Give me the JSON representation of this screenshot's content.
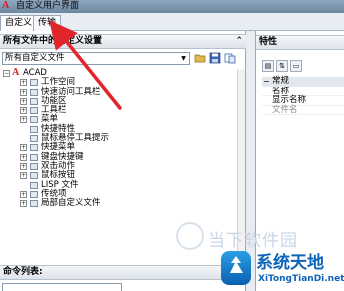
{
  "window": {
    "title": "自定义用户界面",
    "logo": "A"
  },
  "tabs": [
    {
      "label": "自定义"
    },
    {
      "label": "传输"
    }
  ],
  "left_panel": {
    "header": "所有文件中的自定义设置",
    "collapse_glyph": "⌃",
    "filter": {
      "value": "所有自定义文件"
    },
    "tree": {
      "root": "ACAD",
      "items": [
        {
          "label": "工作空间",
          "expander": "+"
        },
        {
          "label": "快速访问工具栏",
          "expander": "+"
        },
        {
          "label": "功能区",
          "expander": "+"
        },
        {
          "label": "工具栏",
          "expander": "+"
        },
        {
          "label": "菜单",
          "expander": "+"
        },
        {
          "label": "快捷特性",
          "expander": ""
        },
        {
          "label": "鼠标悬停工具提示",
          "expander": ""
        },
        {
          "label": "快捷菜单",
          "expander": "+"
        },
        {
          "label": "键盘快捷键",
          "expander": "+"
        },
        {
          "label": "双击动作",
          "expander": "+"
        },
        {
          "label": "鼠标按钮",
          "expander": "+"
        },
        {
          "label": "LISP 文件",
          "expander": ""
        },
        {
          "label": "传统项",
          "expander": "+"
        },
        {
          "label": "局部自定义文件",
          "expander": "+"
        }
      ]
    }
  },
  "command_panel": {
    "header": "命令列表:"
  },
  "right_panel": {
    "header": "特性",
    "category": "常规",
    "properties": [
      {
        "label": "名称",
        "disabled": false
      },
      {
        "label": "显示名称",
        "disabled": false
      },
      {
        "label": "文件名",
        "disabled": true
      }
    ]
  },
  "watermarks": {
    "brand1": "当下软件园",
    "brand2_title": "系统天地",
    "brand2_sub": "XiTongTianDi.net"
  },
  "colors": {
    "arrow": "#e0252b",
    "accent": "#0d64b9"
  }
}
